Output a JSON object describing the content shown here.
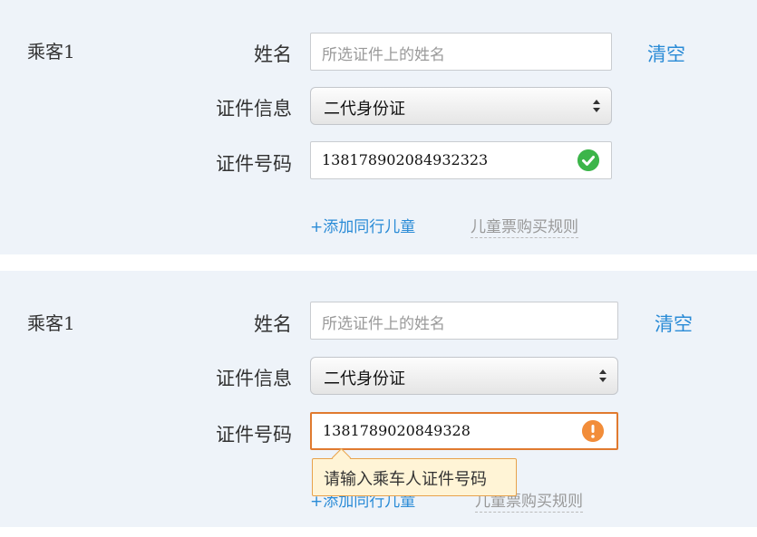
{
  "form1": {
    "passenger": "乘客1",
    "name_label": "姓名",
    "name_placeholder": "所选证件上的姓名",
    "clear": "清空",
    "id_type_label": "证件信息",
    "id_type_value": "二代身份证",
    "id_number_label": "证件号码",
    "id_number_value": "138178902084932323",
    "id_status": "valid",
    "add_child": "+添加同行儿童",
    "child_rules": "儿童票购买规则"
  },
  "form2": {
    "passenger": "乘客1",
    "name_label": "姓名",
    "name_placeholder": "所选证件上的姓名",
    "clear": "清空",
    "id_type_label": "证件信息",
    "id_type_value": "二代身份证",
    "id_number_label": "证件号码",
    "id_number_value": "1381789020849328",
    "id_status": "error",
    "error_tooltip": "请输入乘车人证件号码",
    "add_child": "+添加同行儿童",
    "child_rules": "儿童票购买规则"
  },
  "colors": {
    "panel_bg": "#eef3f9",
    "link": "#2a8bd6",
    "valid": "#3cb54a",
    "error": "#f28d3a"
  },
  "icons": [
    "check-icon",
    "exclamation-icon",
    "select-arrows-icon"
  ]
}
